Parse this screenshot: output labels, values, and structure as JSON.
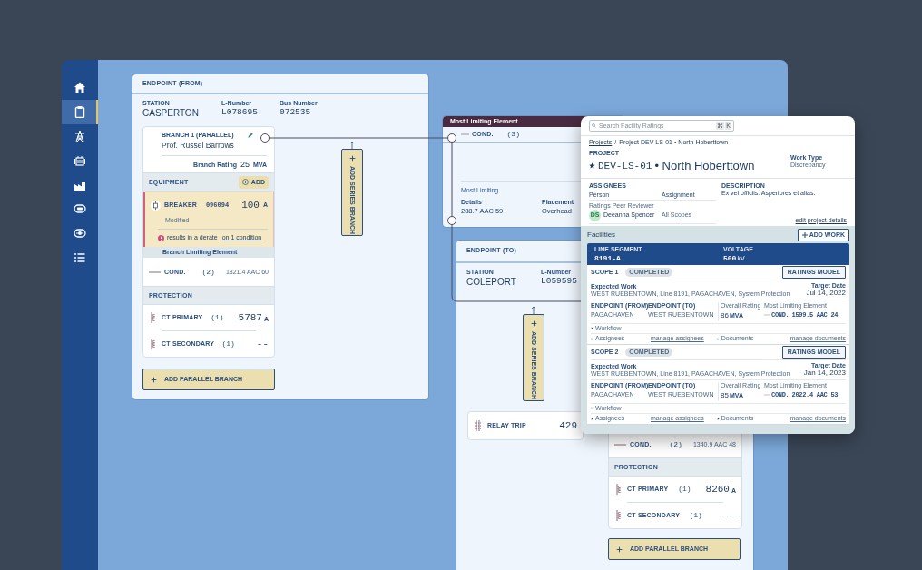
{
  "sidebar": {
    "items": [
      {
        "kind": "home",
        "selected": false
      },
      {
        "kind": "clipboard",
        "selected": true
      },
      {
        "kind": "tower",
        "selected": false
      },
      {
        "kind": "transformer",
        "selected": false
      },
      {
        "kind": "factory",
        "selected": false
      },
      {
        "kind": "breaker",
        "selected": false
      },
      {
        "kind": "relay",
        "selected": false
      },
      {
        "kind": "list",
        "selected": false
      }
    ]
  },
  "endpoint_from": {
    "title": "ENDPOINT (FROM)",
    "fields": [
      {
        "label": "STATION",
        "value": "CASPERTON",
        "kind": "text"
      },
      {
        "label": "L-Number",
        "value": "L078695",
        "kind": "code"
      },
      {
        "label": "Bus Number",
        "value": "072535",
        "kind": "code"
      }
    ],
    "branch": {
      "label": "BRANCH 1 (PARALLEL)",
      "name": "Prof. Russel Barrows",
      "rating_label": "Branch Rating",
      "rating": "25",
      "rating_unit": "MVA"
    },
    "equipment": {
      "title": "EQUIPMENT",
      "add": "ADD",
      "items": [
        {
          "name": "BREAKER",
          "code": "096094",
          "value": "100",
          "unit": "A",
          "modified": true,
          "status": "Modified",
          "warning": "results in a derate",
          "warning_link": "on 1 condition"
        }
      ]
    },
    "limiting": {
      "title": "Branch Limiting Element",
      "name": "COND.",
      "count": "(2)",
      "value": "1821.4 AAC 60"
    },
    "protection": {
      "title": "PROTECTION",
      "items": [
        {
          "name": "CT PRIMARY",
          "count": "(1)",
          "value": "5787",
          "unit": "A"
        },
        {
          "name": "CT SECONDARY",
          "count": "(1)",
          "value": "--"
        }
      ]
    },
    "add_parallel": "ADD PARALLEL BRANCH",
    "add_series": "ADD SERIES BRANCH"
  },
  "most_limiting": {
    "title": "Most Limiting Element",
    "name": "COND.",
    "count": "(3)",
    "subtitle": "Most Limiting",
    "fields": [
      {
        "label": "Details",
        "value": "288.7 AAC 59"
      },
      {
        "label": "Placement",
        "value": "Overhead"
      }
    ]
  },
  "endpoint_to": {
    "title": "ENDPOINT (TO)",
    "fields": [
      {
        "label": "STATION",
        "value": "COLEPORT",
        "kind": "text"
      },
      {
        "label": "L-Number",
        "value": "L059595",
        "kind": "code"
      }
    ],
    "add_series": "ADD SERIES BRANCH",
    "relay": {
      "name": "RELAY TRIP",
      "value": "429"
    },
    "limiting": {
      "name": "COND.",
      "count": "(2)",
      "value": "1340.9 AAC 48"
    },
    "protection": {
      "title": "PROTECTION",
      "items": [
        {
          "name": "CT PRIMARY",
          "count": "(1)",
          "value": "8260",
          "unit": "A"
        },
        {
          "name": "CT SECONDARY",
          "count": "(1)",
          "value": "--"
        }
      ]
    },
    "add_parallel": "ADD PARALLEL BRANCH"
  },
  "project_panel": {
    "search": {
      "placeholder": "Search Facility Ratings",
      "keys": [
        "⌘",
        "K"
      ]
    },
    "breadcrumb": [
      {
        "label": "Projects",
        "kind": "link"
      },
      {
        "label": "Project DEV-LS-01 • North Hoberttown",
        "kind": "current"
      }
    ],
    "breadcrumb_separator": "/",
    "project_label": "PROJECT",
    "starred": true,
    "project_code": "DEV-LS-01",
    "project_name": "• North Hoberttown",
    "work_type_label": "Work Type",
    "work_type": "Discrepancy",
    "assignees": {
      "title": "ASSIGNEES",
      "columns": [
        "Person",
        "Assignment"
      ],
      "rows": [
        {
          "role": "Ratings Peer Reviewer",
          "initials": "DS",
          "person": "Deeanna Spencer",
          "assignment": "All Scopes"
        }
      ]
    },
    "description_label": "DESCRIPTION",
    "description": "Ex vel officiis. Asperiores et alias.",
    "edit_link": "edit project details",
    "facilities": {
      "title": "Facilities",
      "add": "ADD WORK",
      "segment": {
        "label": "LINE SEGMENT",
        "value": "8191-A",
        "voltage_label": "VOLTAGE",
        "voltage": "500",
        "voltage_unit": "kV"
      },
      "scopes": [
        {
          "name": "SCOPE 1",
          "status": "COMPLETED",
          "button": "RATINGS MODEL",
          "expected_label": "Expected Work",
          "expected": "WEST RUEBENTOWN, Line 8191, PAGACHAVEN, System Protection",
          "date_label": "Target Date",
          "date": "Jul 14, 2022",
          "from_label": "ENDPOINT (FROM)",
          "from": "PAGACHAVEN",
          "to_label": "ENDPOINT (TO)",
          "to": "WEST RUEBENTOWN",
          "rating_label": "Overall Rating",
          "rating": "86",
          "rating_unit": "MVA",
          "mle_label": "Most Limiting Element",
          "mle_name": "COND.",
          "mle_value": "1599.5 AAC 24",
          "workflow": "Workflow",
          "assignees": "Assignees",
          "manage_assignees": "manage assignees",
          "documents": "Documents",
          "manage_documents": "manage documents"
        },
        {
          "name": "SCOPE 2",
          "status": "COMPLETED",
          "button": "RATINGS MODEL",
          "expected_label": "Expected Work",
          "expected": "WEST RUEBENTOWN, Line 8191, PAGACHAVEN, System Protection",
          "date_label": "Target Date",
          "date": "Jan 14, 2023",
          "from_label": "ENDPOINT (FROM)",
          "from": "PAGACHAVEN",
          "to_label": "ENDPOINT (TO)",
          "to": "WEST RUEBENTOWN",
          "rating_label": "Overall Rating",
          "rating": "85",
          "rating_unit": "MVA",
          "mle_label": "Most Limiting Element",
          "mle_name": "COND.",
          "mle_value": "2022.4 AAC 53",
          "workflow": "Workflow",
          "assignees": "Assignees",
          "manage_assignees": "manage assignees",
          "documents": "Documents",
          "manage_documents": "manage documents"
        }
      ]
    }
  }
}
